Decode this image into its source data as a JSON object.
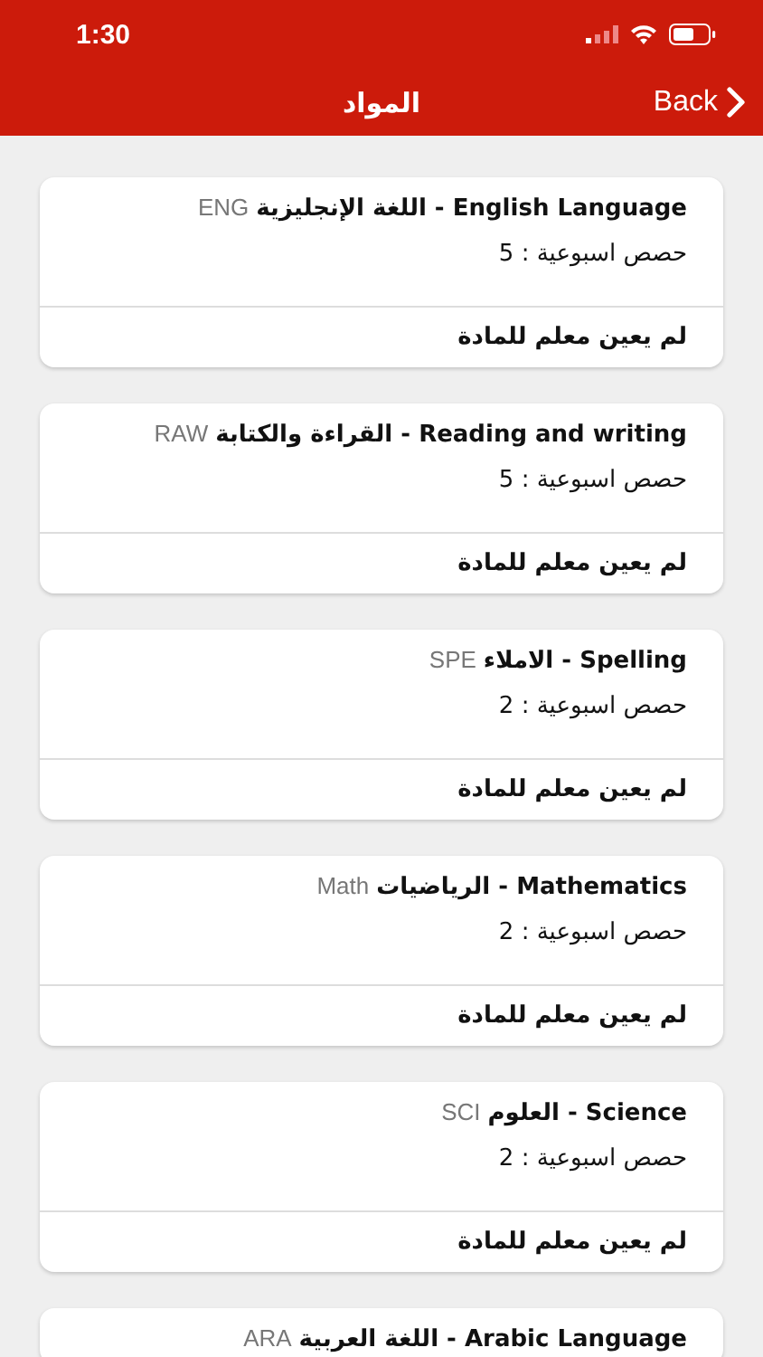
{
  "status_bar": {
    "time": "1:30"
  },
  "nav": {
    "back": "Back",
    "title": "المواد"
  },
  "subjects": [
    {
      "name": "English Language - اللغة الإنجليزية",
      "code": "ENG",
      "hours": "حصص اسبوعية : 5",
      "teacher": "لم يعين معلم للمادة"
    },
    {
      "name": "Reading and writing - القراءة والكتابة",
      "code": "RAW",
      "hours": "حصص اسبوعية : 5",
      "teacher": "لم يعين معلم للمادة"
    },
    {
      "name": "Spelling - الاملاء",
      "code": "SPE",
      "hours": "حصص اسبوعية : 2",
      "teacher": "لم يعين معلم للمادة"
    },
    {
      "name": "Mathematics - الرياضيات",
      "code": "Math",
      "hours": "حصص اسبوعية : 2",
      "teacher": "لم يعين معلم للمادة"
    },
    {
      "name": "Science - العلوم",
      "code": "SCI",
      "hours": "حصص اسبوعية : 2",
      "teacher": "لم يعين معلم للمادة"
    },
    {
      "name": "Arabic Language - اللغة العربية",
      "code": "ARA"
    }
  ]
}
